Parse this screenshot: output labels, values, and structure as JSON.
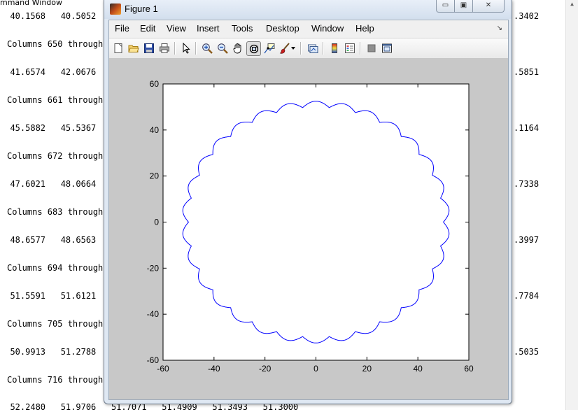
{
  "command_window": {
    "title": "mmand Window",
    "lines": [
      {
        "text": "  40.1568   40.5052"
      },
      {
        "text": "Columns 650 through"
      },
      {
        "text": "  41.6574   42.0676"
      },
      {
        "text": "Columns 661 through"
      },
      {
        "text": "  45.5882   45.5367"
      },
      {
        "text": "Columns 672 through"
      },
      {
        "text": "  47.6021   48.0664"
      },
      {
        "text": "Columns 683 through"
      },
      {
        "text": "  48.6577   48.6563"
      },
      {
        "text": "Columns 694 through"
      },
      {
        "text": "  51.5591   51.6121"
      },
      {
        "text": "Columns 705 through"
      },
      {
        "text": "  50.9913   51.2788"
      },
      {
        "text": "Columns 716 through"
      },
      {
        "text": "  52.2480   51.9706   51.7071   51.4909   51.3493   51.3000"
      }
    ],
    "right_values": [
      ".3402",
      ".5851",
      ".1164",
      ".7338",
      ".3997",
      ".7784",
      ".5035"
    ]
  },
  "figure": {
    "title": "Figure 1",
    "window_buttons": {
      "minimize": "▭",
      "maximize": "▣",
      "close": "✕"
    },
    "menu": [
      "File",
      "Edit",
      "View",
      "Insert",
      "Tools",
      "Desktop",
      "Window",
      "Help"
    ],
    "menu_dock_arrow": "↘",
    "toolbar": [
      {
        "icon": "new-figure-icon"
      },
      {
        "icon": "open-file-icon"
      },
      {
        "icon": "save-figure-icon"
      },
      {
        "icon": "print-figure-icon"
      },
      {
        "icon": "edit-plot-arrow-icon"
      },
      {
        "icon": "zoom-in-icon"
      },
      {
        "icon": "zoom-out-icon"
      },
      {
        "icon": "pan-hand-icon"
      },
      {
        "icon": "rotate-3d-icon",
        "active": true
      },
      {
        "icon": "data-cursor-icon"
      },
      {
        "icon": "brush-icon"
      },
      {
        "icon": "link-plot-icon"
      },
      {
        "icon": "insert-colorbar-icon"
      },
      {
        "icon": "insert-legend-icon"
      },
      {
        "icon": "hide-plot-tools-icon"
      },
      {
        "icon": "show-plot-tools-icon"
      }
    ]
  },
  "chart_data": {
    "type": "line",
    "title": "",
    "xlabel": "",
    "ylabel": "",
    "xlim": [
      -60,
      60
    ],
    "ylim": [
      -60,
      60
    ],
    "xticks": [
      -60,
      -40,
      -20,
      0,
      20,
      40,
      60
    ],
    "yticks": [
      -60,
      -40,
      -20,
      0,
      20,
      40,
      60
    ],
    "grid": false,
    "line_color": "#0000ff",
    "series": [
      {
        "curve": "scalloped circle (epicycloid-like)",
        "base_radius": 50,
        "bump_amplitude": 2.5,
        "bump_count": 30
      }
    ]
  }
}
